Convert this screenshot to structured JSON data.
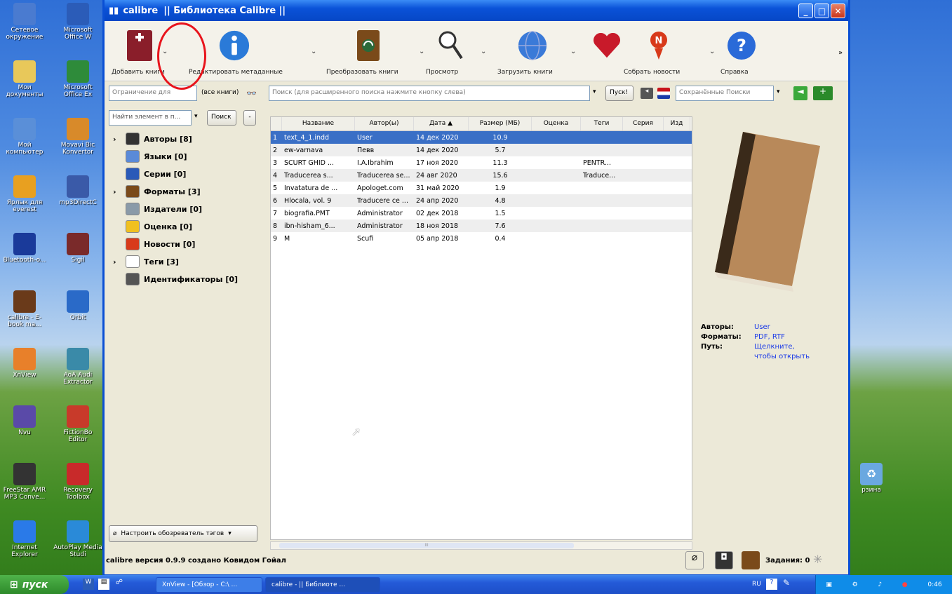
{
  "desktop": {
    "icons": [
      {
        "label": "Сетевое окружение",
        "icon": "network-icon",
        "color": "#4a7bd0"
      },
      {
        "label": "Microsoft Office W",
        "icon": "word-icon",
        "color": "#2b5cb8"
      },
      {
        "label": "Мои документы",
        "icon": "folder-icon",
        "color": "#e8c85a"
      },
      {
        "label": "Microsoft Office Ex",
        "icon": "excel-icon",
        "color": "#2e8b3a"
      },
      {
        "label": "Мой компьютер",
        "icon": "computer-icon",
        "color": "#5a8fd8"
      },
      {
        "label": "Movavi Bic Konvertor",
        "icon": "movavi-icon",
        "color": "#d88a2a"
      },
      {
        "label": "Ярлык для everest",
        "icon": "everest-icon",
        "color": "#e8a020"
      },
      {
        "label": "mp3DirectC",
        "icon": "mp3-icon",
        "color": "#3a5aa8"
      },
      {
        "label": "Bluetooth-o...",
        "icon": "bluetooth-icon",
        "color": "#1a3a9a"
      },
      {
        "label": "Sigil",
        "icon": "sigil-icon",
        "color": "#7a2a2a"
      },
      {
        "label": "calibre - E-book ma...",
        "icon": "calibre-icon",
        "color": "#6a3a1a"
      },
      {
        "label": "Orbit",
        "icon": "orbit-icon",
        "color": "#2a6ac8"
      },
      {
        "label": "XnView",
        "icon": "xnview-icon",
        "color": "#e8802a"
      },
      {
        "label": "AoA Audi Extractor",
        "icon": "aoa-icon",
        "color": "#3a8aa8"
      },
      {
        "label": "Nvu",
        "icon": "nvu-icon",
        "color": "#5a4aa8"
      },
      {
        "label": "FictionBo Editor",
        "icon": "fb-icon",
        "color": "#c83a2a"
      },
      {
        "label": "FreeStar AMR MP3 Conve...",
        "icon": "film-icon",
        "color": "#333333"
      },
      {
        "label": "Recovery Toolbox",
        "icon": "recovery-icon",
        "color": "#c82a2a"
      },
      {
        "label": "Internet Explorer",
        "icon": "ie-icon",
        "color": "#2a7ae8"
      },
      {
        "label": "AutoPlay Media Studi",
        "icon": "autoplay-icon",
        "color": "#2a8ad8"
      }
    ],
    "recycle_label": "рзина"
  },
  "window": {
    "title": "calibre",
    "library": "|| Библиотека Calibre ||",
    "buttons": {
      "min": "_",
      "max": "□",
      "close": "✕"
    }
  },
  "toolbar": {
    "add": "Добавить книги",
    "edit": "Редактировать метаданные",
    "convert": "Преобразовать книги",
    "view": "Просмотр",
    "get": "Загрузить книги",
    "news": "Собрать новости",
    "help": "Справка",
    "more": "»",
    "caret": "⌄"
  },
  "search": {
    "restrict": "Ограничение для",
    "all_books": "(все книги)",
    "placeholder": "Поиск (для расширенного поиска нажмите кнопку слева)",
    "go": "Пуск!",
    "saved": "Сохранённые Поиски"
  },
  "tagbrowser": {
    "find_placeholder": "Найти элемент в п...",
    "find_btn": "Поиск",
    "minus": "-",
    "items": [
      {
        "label": "Авторы [8]",
        "expand": "›"
      },
      {
        "label": "Языки [0]",
        "expand": ""
      },
      {
        "label": "Серии [0]",
        "expand": ""
      },
      {
        "label": "Форматы [3]",
        "expand": "›"
      },
      {
        "label": "Издатели [0]",
        "expand": ""
      },
      {
        "label": "Оценка [0]",
        "expand": ""
      },
      {
        "label": "Новости [0]",
        "expand": ""
      },
      {
        "label": "Теги [3]",
        "expand": "›"
      },
      {
        "label": "Идентификаторы [0]",
        "expand": ""
      }
    ],
    "configure": "Настроить обозреватель тэгов"
  },
  "booklist": {
    "columns": [
      "Название",
      "Автор(ы)",
      "Дата ▲",
      "Размер (МБ)",
      "Оценка",
      "Теги",
      "Серия",
      "Изд"
    ],
    "rows": [
      {
        "n": "1",
        "title": "text_4_1.indd",
        "author": "User",
        "date": "14 дек 2020",
        "size": "10.9",
        "tags": ""
      },
      {
        "n": "2",
        "title": "ew-varnava",
        "author": "Певв",
        "date": "14 дек 2020",
        "size": "5.7",
        "tags": ""
      },
      {
        "n": "3",
        "title": "SCURT GHID ...",
        "author": "I.A.Ibrahim",
        "date": "17 ноя 2020",
        "size": "11.3",
        "tags": "PENTR..."
      },
      {
        "n": "4",
        "title": "Traducerea s...",
        "author": "Traducerea se...",
        "date": "24 авг 2020",
        "size": "15.6",
        "tags": "Traduce..."
      },
      {
        "n": "5",
        "title": "Invatatura de ...",
        "author": "Apologet.com",
        "date": "31 май 2020",
        "size": "1.9",
        "tags": ""
      },
      {
        "n": "6",
        "title": "Hlocala, vol. 9",
        "author": "Traducere ce ...",
        "date": "24 апр 2020",
        "size": "4.8",
        "tags": ""
      },
      {
        "n": "7",
        "title": "biografia.PMT",
        "author": "Administrator",
        "date": "02 дек 2018",
        "size": "1.5",
        "tags": ""
      },
      {
        "n": "8",
        "title": "ibn-hisham_6...",
        "author": "Administrator",
        "date": "18 ноя 2018",
        "size": "7.6",
        "tags": ""
      },
      {
        "n": "9",
        "title": "M",
        "author": "Scufi",
        "date": "05 апр 2018",
        "size": "0.4",
        "tags": ""
      }
    ],
    "scroll_hint": "III"
  },
  "details": {
    "authors_label": "Авторы:",
    "authors_value": "User",
    "formats_label": "Форматы:",
    "formats_value": "PDF, RTF",
    "path_label": "Путь:",
    "path_value": "Щелкните, чтобы открыть"
  },
  "status": {
    "version": "calibre версия 0.9.9 создано Ковидом Гойал",
    "jobs": "Задания: 0"
  },
  "taskbar": {
    "start": "пуск",
    "tasks": [
      "XnView - [Обзор - C:\\ ...",
      "calibre - || Библиоте ..."
    ],
    "lang": "RU",
    "clock": "0:46"
  },
  "colors": {
    "accent": "#0a52d8",
    "selection": "#3a6fc6",
    "annotation": "#e8141c",
    "link": "#1a3ae8"
  }
}
